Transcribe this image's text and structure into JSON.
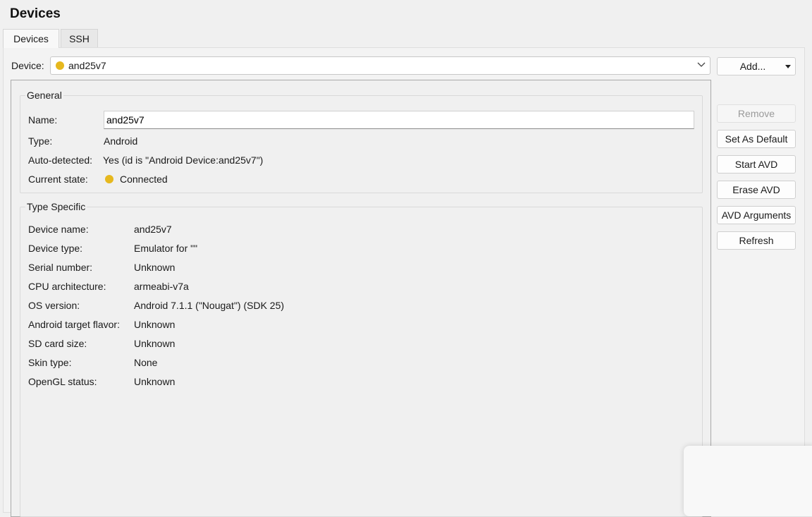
{
  "header": {
    "title": "Devices"
  },
  "tabs": [
    {
      "label": "Devices"
    },
    {
      "label": "SSH"
    }
  ],
  "device_selector": {
    "label": "Device:",
    "value": "and25v7",
    "status_color": "#e6b81e"
  },
  "buttons": {
    "add": "Add...",
    "remove": "Remove",
    "set_default": "Set As Default",
    "start_avd": "Start AVD",
    "erase_avd": "Erase AVD",
    "avd_arguments": "AVD Arguments",
    "refresh": "Refresh"
  },
  "general": {
    "title": "General",
    "name_label": "Name:",
    "name_value": "and25v7",
    "type_label": "Type:",
    "type_value": "Android",
    "auto_detected_label": "Auto-detected:",
    "auto_detected_value": "Yes (id is \"Android Device:and25v7\")",
    "current_state_label": "Current state:",
    "current_state_value": "Connected"
  },
  "type_specific": {
    "title": "Type Specific",
    "rows": [
      {
        "label": "Device name:",
        "value": "and25v7"
      },
      {
        "label": "Device type:",
        "value": "Emulator for \"\""
      },
      {
        "label": "Serial number:",
        "value": "Unknown"
      },
      {
        "label": "CPU architecture:",
        "value": "armeabi-v7a"
      },
      {
        "label": "OS version:",
        "value": "Android 7.1.1 (\"Nougat\") (SDK 25)"
      },
      {
        "label": "Android target flavor:",
        "value": "Unknown"
      },
      {
        "label": "SD card size:",
        "value": "Unknown"
      },
      {
        "label": "Skin type:",
        "value": "None"
      },
      {
        "label": "OpenGL status:",
        "value": "Unknown"
      }
    ]
  }
}
